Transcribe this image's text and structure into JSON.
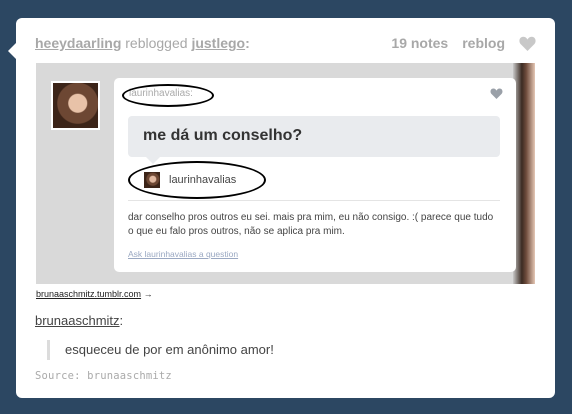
{
  "post": {
    "reblogger": "heeydaarling",
    "action": "reblogged",
    "origin": "justlego",
    "colon": ":",
    "notes": "19 notes",
    "reblog_label": "reblog",
    "like_icon": "heart-icon"
  },
  "screenshot": {
    "asker": "laurinhavalias:",
    "question": "me dá um conselho?",
    "answerer": "laurinhavalias",
    "answer": "dar conselho pros outros eu sei. mais pra mim, eu não consigo. :( parece que tudo o que eu falo pros outros, não se aplica pra mim.",
    "ask_link": "Ask laurinhavalias a question"
  },
  "source_url": "brunaaschmitz.tumblr.com",
  "source_arrow": "→",
  "comment": {
    "blog": "brunaaschmitz",
    "colon": ":",
    "quote": "esqueceu de por em anônimo amor!"
  },
  "source_label": "Source: brunaaschmitz",
  "colors": {
    "background": "#2c4762",
    "card": "#ffffff",
    "meta": "#a8a8a8"
  }
}
